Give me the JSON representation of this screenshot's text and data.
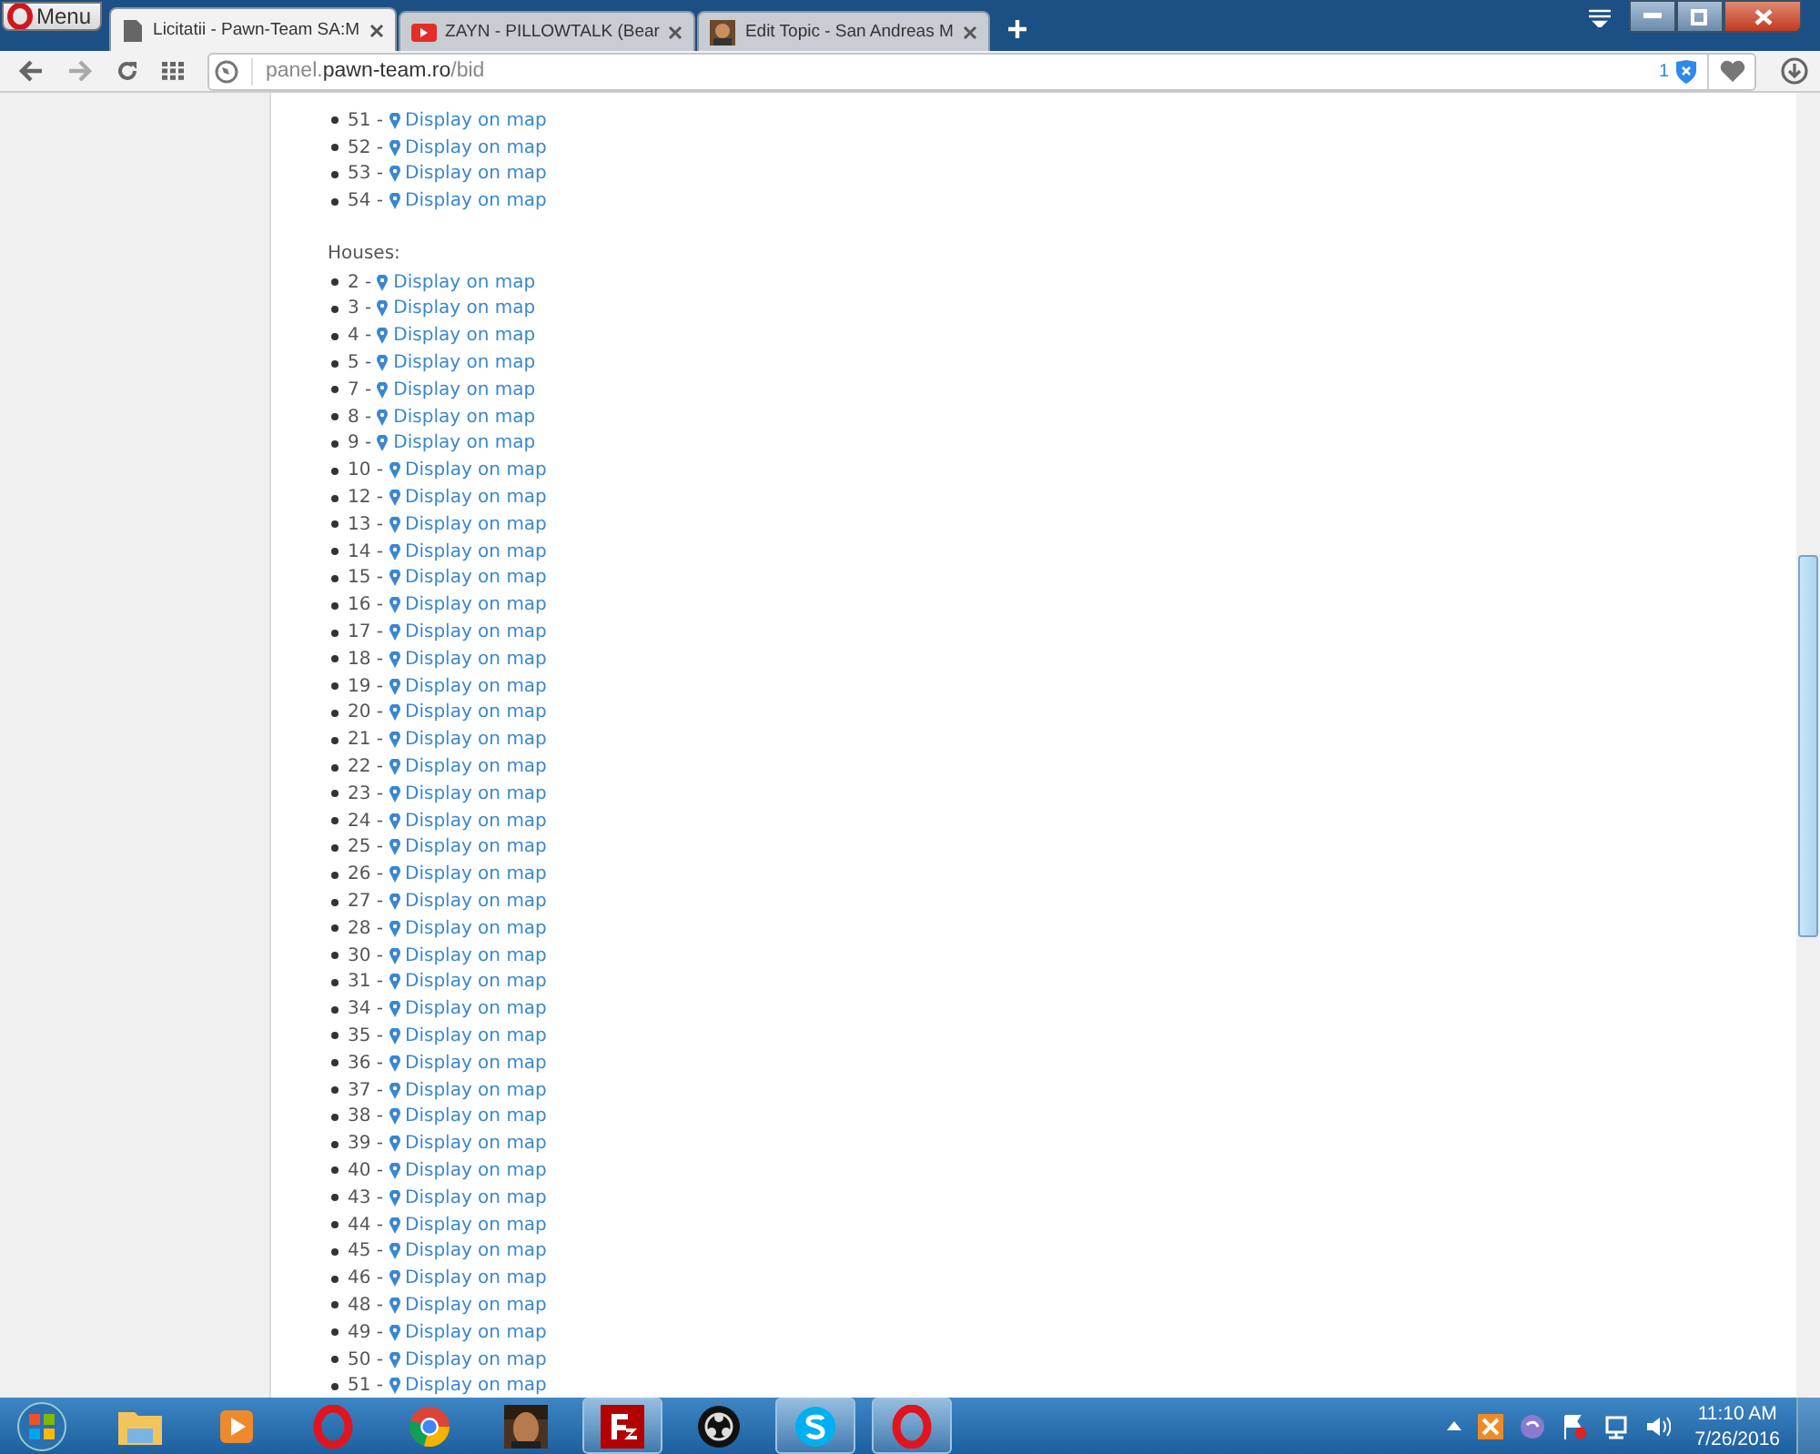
{
  "browser": {
    "menu_label": "Menu",
    "tabs": [
      {
        "title": "Licitatii - Pawn-Team SA:M",
        "selected": true
      },
      {
        "title": "ZAYN - PILLOWTALK (Bear",
        "selected": false
      },
      {
        "title": "Edit Topic - San Andreas M",
        "selected": false
      }
    ],
    "url": {
      "prefix": "panel.",
      "host": "pawn-team.ro",
      "path": "/bid"
    },
    "blocked_count": "1"
  },
  "page": {
    "sections": [
      {
        "items": [
          {
            "number": "51 -",
            "link": "Display on map"
          },
          {
            "number": "52 -",
            "link": "Display on map"
          },
          {
            "number": "53 -",
            "link": "Display on map"
          },
          {
            "number": "54 -",
            "link": "Display on map"
          }
        ]
      },
      {
        "heading": "Houses:",
        "items": [
          {
            "number": "2 -",
            "link": "Display on map"
          },
          {
            "number": "3 -",
            "link": "Display on map"
          },
          {
            "number": "4 -",
            "link": "Display on map"
          },
          {
            "number": "5 -",
            "link": "Display on map"
          },
          {
            "number": "7 -",
            "link": "Display on map"
          },
          {
            "number": "8 -",
            "link": "Display on map"
          },
          {
            "number": "9 -",
            "link": "Display on map"
          },
          {
            "number": "10 -",
            "link": "Display on map"
          },
          {
            "number": "12 -",
            "link": "Display on map"
          },
          {
            "number": "13 -",
            "link": "Display on map"
          },
          {
            "number": "14 -",
            "link": "Display on map"
          },
          {
            "number": "15 -",
            "link": "Display on map"
          },
          {
            "number": "16 -",
            "link": "Display on map"
          },
          {
            "number": "17 -",
            "link": "Display on map"
          },
          {
            "number": "18 -",
            "link": "Display on map"
          },
          {
            "number": "19 -",
            "link": "Display on map"
          },
          {
            "number": "20 -",
            "link": "Display on map"
          },
          {
            "number": "21 -",
            "link": "Display on map"
          },
          {
            "number": "22 -",
            "link": "Display on map"
          },
          {
            "number": "23 -",
            "link": "Display on map"
          },
          {
            "number": "24 -",
            "link": "Display on map"
          },
          {
            "number": "25 -",
            "link": "Display on map"
          },
          {
            "number": "26 -",
            "link": "Display on map"
          },
          {
            "number": "27 -",
            "link": "Display on map"
          },
          {
            "number": "28 -",
            "link": "Display on map"
          },
          {
            "number": "30 -",
            "link": "Display on map"
          },
          {
            "number": "31 -",
            "link": "Display on map"
          },
          {
            "number": "34 -",
            "link": "Display on map"
          },
          {
            "number": "35 -",
            "link": "Display on map"
          },
          {
            "number": "36 -",
            "link": "Display on map"
          },
          {
            "number": "37 -",
            "link": "Display on map"
          },
          {
            "number": "38 -",
            "link": "Display on map"
          },
          {
            "number": "39 -",
            "link": "Display on map"
          },
          {
            "number": "40 -",
            "link": "Display on map"
          },
          {
            "number": "43 -",
            "link": "Display on map"
          },
          {
            "number": "44 -",
            "link": "Display on map"
          },
          {
            "number": "45 -",
            "link": "Display on map"
          },
          {
            "number": "46 -",
            "link": "Display on map"
          },
          {
            "number": "48 -",
            "link": "Display on map"
          },
          {
            "number": "49 -",
            "link": "Display on map"
          },
          {
            "number": "50 -",
            "link": "Display on map"
          },
          {
            "number": "51 -",
            "link": "Display on map"
          }
        ]
      }
    ]
  },
  "taskbar": {
    "apps": [
      {
        "kind": "folder",
        "selected": false
      },
      {
        "kind": "player",
        "selected": false
      },
      {
        "kind": "opera",
        "selected": false
      },
      {
        "kind": "chrome",
        "selected": false
      },
      {
        "kind": "game",
        "selected": false
      },
      {
        "kind": "filezilla",
        "selected": true
      },
      {
        "kind": "obs",
        "selected": false
      },
      {
        "kind": "skype",
        "selected": true
      },
      {
        "kind": "opera",
        "selected": true
      }
    ],
    "time": "11:10 AM",
    "date": "7/26/2016"
  }
}
